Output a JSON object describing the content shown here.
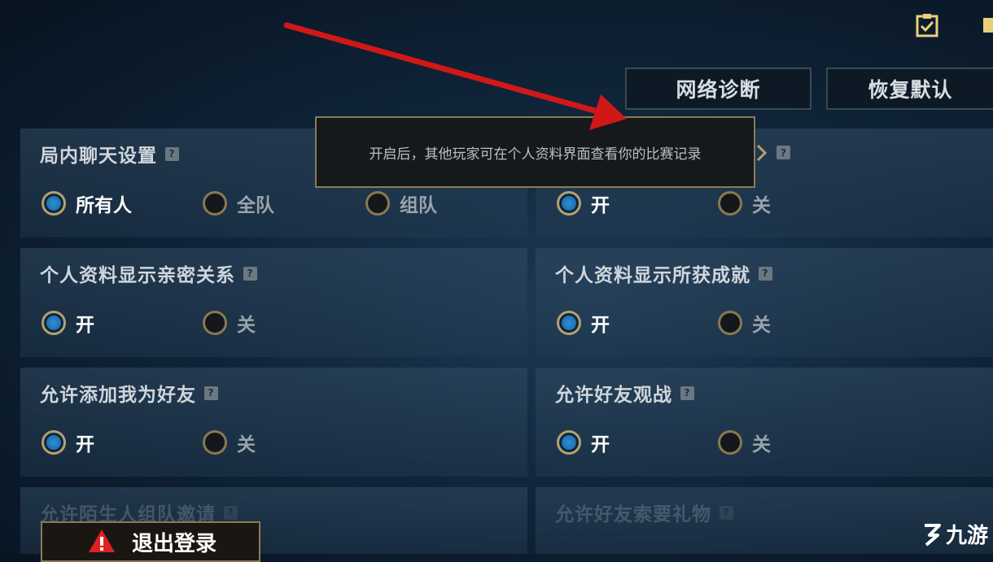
{
  "toolbar": {
    "network_diagnostics": "网络诊断",
    "restore_defaults": "恢复默认"
  },
  "tooltip": {
    "text": "开启后，其他玩家可在个人资料界面查看你的比赛记录"
  },
  "settings": {
    "chat": {
      "title": "局内聊天设置",
      "options": [
        "所有人",
        "全队",
        "组队"
      ],
      "selected": "所有人"
    },
    "match_history": {
      "options": [
        "开",
        "关"
      ],
      "selected": "开"
    },
    "intimacy": {
      "title": "个人资料显示亲密关系",
      "options": [
        "开",
        "关"
      ],
      "selected": "开"
    },
    "achievements": {
      "title": "个人资料显示所获成就",
      "options": [
        "开",
        "关"
      ],
      "selected": "开"
    },
    "add_friend": {
      "title": "允许添加我为好友",
      "options": [
        "开",
        "关"
      ],
      "selected": "开"
    },
    "spectate": {
      "title": "允许好友观战",
      "options": [
        "开",
        "关"
      ],
      "selected": "开"
    },
    "stranger_invite": {
      "title": "允许陌生人组队邀请"
    },
    "gift_request": {
      "title": "允许好友索要礼物"
    }
  },
  "help_glyph": "?",
  "logout": {
    "label": "退出登录"
  },
  "watermark": {
    "text": "九游"
  },
  "colors": {
    "accent_blue": "#2f8fd0",
    "gold_border": "#8a7b55",
    "arrow_red": "#d01818"
  }
}
